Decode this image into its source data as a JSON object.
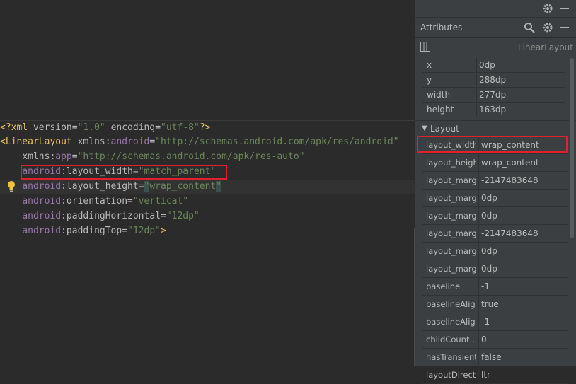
{
  "editor": {
    "lines": {
      "l1": {
        "p1": "<?",
        "tag": "xml",
        "sp1": " ",
        "a1": "version",
        "eq1": "=",
        "s1": "\"1.0\"",
        "sp2": " ",
        "a2": "encoding",
        "eq2": "=",
        "s2": "\"utf-8\"",
        "p2": "?>"
      },
      "l2": {
        "p1": "<",
        "tag": "LinearLayout",
        "sp1": " ",
        "a1": "xmlns:",
        "ns1": "android",
        "eq1": "=",
        "s1": "\"http://schemas.android.com/apk/res/android\""
      },
      "l3": {
        "indent": "    ",
        "a1": "xmlns:",
        "ns1": "app",
        "eq1": "=",
        "s1": "\"http://schemas.android.com/apk/res-auto\""
      },
      "l4": {
        "indent": "    ",
        "ns": "android",
        "attr": ":layout_width",
        "eq": "=",
        "val": "\"match_parent\""
      },
      "l5": {
        "indent": "    ",
        "ns": "android",
        "attr": ":layout_height",
        "eq": "=",
        "q1": "\"",
        "val": "wrap_content",
        "q2": "\""
      },
      "l6": {
        "indent": "    ",
        "ns": "android",
        "attr": ":orientation",
        "eq": "=",
        "val": "\"vertical\""
      },
      "l7": {
        "indent": "    ",
        "ns": "android",
        "attr": ":paddingHorizontal",
        "eq": "=",
        "val": "\"12dp\""
      },
      "l8": {
        "indent": "    ",
        "ns": "android",
        "attr": ":paddingTop",
        "eq": "=",
        "val": "\"12dp\"",
        "end": ">"
      }
    }
  },
  "panel": {
    "title": "Attributes",
    "view_class": "LinearLayout",
    "view_attrs": [
      {
        "k": "x",
        "v": "0dp"
      },
      {
        "k": "y",
        "v": "288dp"
      },
      {
        "k": "width",
        "v": "277dp"
      },
      {
        "k": "height",
        "v": "163dp"
      }
    ],
    "section_label": "Layout",
    "layout_attrs": [
      {
        "k": "layout_width",
        "v": "wrap_content"
      },
      {
        "k": "layout_height",
        "v": "wrap_content"
      },
      {
        "k": "layout_marg…",
        "v": "-2147483648"
      },
      {
        "k": "layout_marg…",
        "v": "0dp"
      },
      {
        "k": "layout_marg…",
        "v": "0dp"
      },
      {
        "k": "layout_marg…",
        "v": "-2147483648"
      },
      {
        "k": "layout_marg…",
        "v": "0dp"
      },
      {
        "k": "layout_marg…",
        "v": "0dp"
      },
      {
        "k": "baseline",
        "v": "-1"
      },
      {
        "k": "baselineAlig…",
        "v": "true"
      },
      {
        "k": "baselineAlig…",
        "v": "-1"
      },
      {
        "k": "childCount…",
        "v": "0"
      },
      {
        "k": "hasTransient…",
        "v": "false"
      },
      {
        "k": "layoutDirect…",
        "v": "ltr"
      }
    ]
  },
  "colors": {
    "highlight": "#e0202a",
    "editor_bg": "#2b2b2b",
    "panel_bg": "#3c3f41"
  },
  "icons": [
    "gear-icon",
    "minimize-icon",
    "search-icon",
    "columns-icon",
    "lightbulb-icon",
    "collapse-triangle-icon"
  ]
}
